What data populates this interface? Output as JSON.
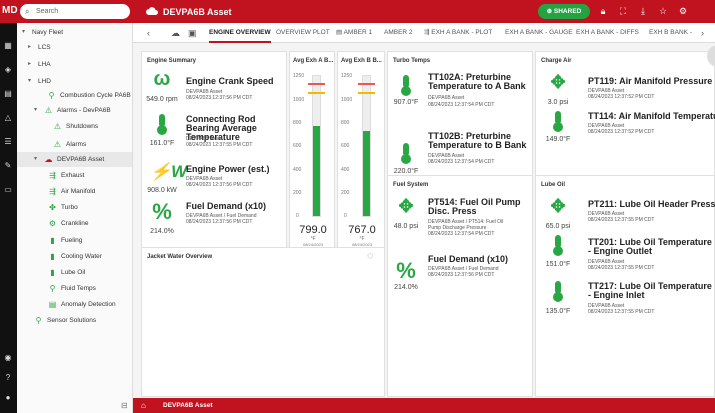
{
  "app": {
    "logo": "MD",
    "search_placeholder": "Search",
    "asset_title": "DEVPA6B Asset",
    "shared_label": "SHARED"
  },
  "sidebar": {
    "items": [
      {
        "label": "Navy Fleet"
      },
      {
        "label": "LCS"
      },
      {
        "label": "LHA"
      },
      {
        "label": "LHD"
      },
      {
        "label": "Combustion Cycle PA6B"
      },
      {
        "label": "Alarms - DevPA6B"
      },
      {
        "label": "Shutdowns"
      },
      {
        "label": "Alarms"
      },
      {
        "label": "DEVPA6B Asset"
      },
      {
        "label": "Exhaust"
      },
      {
        "label": "Air Manifold"
      },
      {
        "label": "Turbo"
      },
      {
        "label": "Crankline"
      },
      {
        "label": "Fueling"
      },
      {
        "label": "Cooling Water"
      },
      {
        "label": "Lube Oil"
      },
      {
        "label": "Fluid Temps"
      },
      {
        "label": "Anomaly Detection"
      },
      {
        "label": "Sensor Solutions"
      }
    ]
  },
  "tabs": [
    "ENGINE OVERVIEW",
    "OVERVIEW PLOT",
    "AMBER 1",
    "AMBER 2",
    "EXH A BANK - PLOT",
    "EXH A BANK - GAUGE",
    "EXH A BANK - DIFFS",
    "EXH B BANK -"
  ],
  "panels": {
    "engine_summary": {
      "title": "Engine Summary",
      "metrics": [
        {
          "icon": "engine-icon",
          "glyph": "ω",
          "value": "549.0 rpm",
          "title": "Engine Crank Speed",
          "sub1": "DEVPA6B Asset",
          "sub2": "08/24/2023 12:37:56 PM CDT"
        },
        {
          "icon": "thermometer-icon",
          "glyph": "🌡",
          "value": "161.0°F",
          "title": "Connecting Rod Bearing Average Temperature",
          "sub1": "DEVPA6B Asset",
          "sub2": "08/24/2023 12:37:55 PM CDT"
        },
        {
          "icon": "power-icon",
          "glyph": "⚡",
          "value": "908.0 kW",
          "title": "Engine Power (est.)",
          "sub1": "DEVPA6B Asset",
          "sub2": "08/24/2023 12:37:56 PM CDT"
        },
        {
          "icon": "percent-icon",
          "glyph": "%",
          "value": "214.0%",
          "title": "Fuel Demand (x10)",
          "sub1": "DEVPA6B Asset / Fuel Demand",
          "sub2": "08/24/2023 12:37:56 PM CDT"
        }
      ]
    },
    "gauge_a": {
      "title": "Avg Exh A B...",
      "scale": [
        "1250",
        "1000",
        "800",
        "600",
        "400",
        "200",
        "0"
      ],
      "value": "799.0",
      "unit": "°F",
      "ts1": "08/24/2023",
      "ts2": "12:37:56 PM CDT",
      "fill": 0.64
    },
    "gauge_b": {
      "title": "Avg Exh B B...",
      "scale": [
        "1250",
        "1000",
        "800",
        "600",
        "400",
        "200",
        "0"
      ],
      "value": "767.0",
      "unit": "°F",
      "ts1": "08/24/2023",
      "ts2": "12:37:56 PM CDT",
      "fill": 0.61
    },
    "turbo": {
      "title": "Turbo Temps",
      "metrics": [
        {
          "icon": "thermometer-icon",
          "value": "907.0°F",
          "title": "TT102A: Preturbine Temperature to A Bank",
          "sub1": "DEVPA6B Asset",
          "sub2": "08/24/2023 12:37:54 PM CDT"
        },
        {
          "icon": "thermometer-icon",
          "value": "220.0°F",
          "title": "TT102B: Preturbine Temperature to B Bank",
          "sub1": "DEVPA6B Asset",
          "sub2": "08/24/2023 12:37:54 PM CDT"
        }
      ]
    },
    "charge_air": {
      "title": "Charge Air",
      "metrics": [
        {
          "icon": "manifold-icon",
          "value": "3.0 psi",
          "title": "PT119: Air Manifold Pressure",
          "sub1": "DEVPA6B Asset",
          "sub2": "08/24/2023 12:37:52 PM CDT"
        },
        {
          "icon": "thermometer-icon",
          "value": "149.0°F",
          "title": "TT114: Air Manifold Temperatur",
          "sub1": "DEVPA6B Asset",
          "sub2": "08/24/2023 12:37:52 PM CDT"
        }
      ]
    },
    "jacket": {
      "title": "Jacket Water Overview"
    },
    "fuel": {
      "title": "Fuel System",
      "metrics": [
        {
          "icon": "manifold-icon",
          "value": "48.0 psi",
          "title": "PT514: Fuel Oil Pump Disc. Press",
          "sub1": "DEVPA6B Asset / PT514: Fuel Oil",
          "sub1b": "Pump Discharge Pressure",
          "sub2": "08/24/2023 12:37:54 PM CDT"
        },
        {
          "icon": "percent-icon",
          "value": "214.0%",
          "title": "Fuel Demand (x10)",
          "sub1": "DEVPA6B Asset / Fuel Demand",
          "sub2": "08/24/2023 12:37:56 PM CDT"
        }
      ]
    },
    "lube": {
      "title": "Lube Oil",
      "metrics": [
        {
          "icon": "manifold-icon",
          "value": "65.0 psi",
          "title": "PT211: Lube Oil Header Pressur",
          "sub1": "DEVPA6B Asset",
          "sub2": "08/24/2023 12:37:55 PM CDT"
        },
        {
          "icon": "thermometer-icon",
          "value": "151.0°F",
          "title": "TT201: Lube Oil Temperature - Engine Outlet",
          "sub1": "DEVPA6B Asset",
          "sub2": "08/24/2023 12:37:55 PM CDT"
        },
        {
          "icon": "thermometer-icon",
          "value": "135.0°F",
          "title": "TT217: Lube Oil Temperature - Engine Inlet",
          "sub1": "DEVPA6B Asset",
          "sub2": "08/24/2023 12:37:55 PM CDT"
        }
      ]
    }
  },
  "footer": {
    "label": "DEVPA6B Asset"
  },
  "colors": {
    "brand": "#c1121f",
    "ok": "#2aa745"
  }
}
